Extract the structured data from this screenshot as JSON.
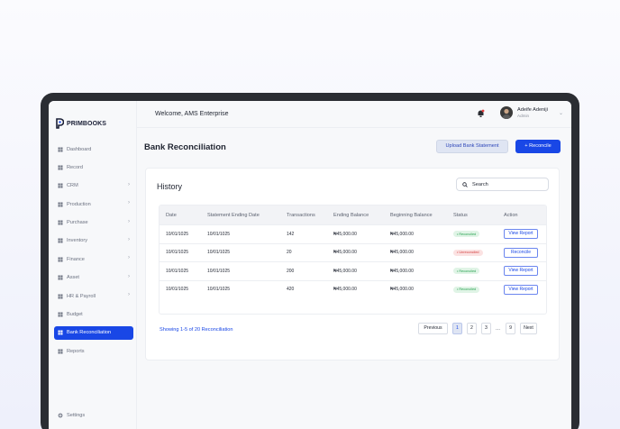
{
  "app": {
    "logo_text": "PRIMBOOKS"
  },
  "sidebar": {
    "items": [
      {
        "label": "Dashboard",
        "icon": "dashboard-icon",
        "has_chevron": false
      },
      {
        "label": "Record",
        "icon": "record-icon",
        "has_chevron": false
      },
      {
        "label": "CRM",
        "icon": "crm-icon",
        "has_chevron": true
      },
      {
        "label": "Production",
        "icon": "production-icon",
        "has_chevron": true
      },
      {
        "label": "Purchase",
        "icon": "purchase-icon",
        "has_chevron": true
      },
      {
        "label": "Inventory",
        "icon": "inventory-icon",
        "has_chevron": true
      },
      {
        "label": "Finance",
        "icon": "finance-icon",
        "has_chevron": true
      },
      {
        "label": "Asset",
        "icon": "asset-icon",
        "has_chevron": true
      },
      {
        "label": "HR & Payroll",
        "icon": "hr-icon",
        "has_chevron": true
      },
      {
        "label": "Budget",
        "icon": "budget-icon",
        "has_chevron": false
      },
      {
        "label": "Bank Reconciliation",
        "icon": "bank-icon",
        "has_chevron": false
      },
      {
        "label": "Reports",
        "icon": "reports-icon",
        "has_chevron": false
      }
    ],
    "active_index": 10,
    "settings_label": "Settings"
  },
  "header": {
    "welcome": "Welcome, AMS Enterprise",
    "user_name": "Adeife Adeniji",
    "user_role": "Admin"
  },
  "main": {
    "title": "Bank Reconciliation",
    "upload_button": "Upload Bank Statement",
    "reconcile_button": "+ Reconcile",
    "history_title": "History",
    "search_placeholder": "Search",
    "columns": [
      "Date",
      "Statement Ending Date",
      "Transactions",
      "Ending Balance",
      "Beginning Balance",
      "Status",
      "Action"
    ],
    "rows": [
      {
        "date": "10/01/1025",
        "ending_date": "10/01/1025",
        "transactions": "142",
        "ending_balance": "₦45,000.00",
        "beginning_balance": "₦45,000.00",
        "status": "• Reconciled",
        "status_type": "ok",
        "action": "View Report"
      },
      {
        "date": "10/01/1025",
        "ending_date": "10/01/1025",
        "transactions": "20",
        "ending_balance": "₦45,000.00",
        "beginning_balance": "₦45,000.00",
        "status": "• Unreconciled",
        "status_type": "bad",
        "action": "Reconcile"
      },
      {
        "date": "10/01/1025",
        "ending_date": "10/01/1025",
        "transactions": "200",
        "ending_balance": "₦45,000.00",
        "beginning_balance": "₦45,000.00",
        "status": "• Reconciled",
        "status_type": "ok",
        "action": "View Report"
      },
      {
        "date": "10/01/1025",
        "ending_date": "10/01/1025",
        "transactions": "420",
        "ending_balance": "₦45,000.00",
        "beginning_balance": "₦45,000.00",
        "status": "• Reconciled",
        "status_type": "ok",
        "action": "View Report"
      }
    ],
    "showing_text": "Showing 1-5 of 20 Reconciliation",
    "pager": {
      "previous": "Previous",
      "pages": [
        "1",
        "2",
        "3"
      ],
      "ellipsis": "...",
      "last": "9",
      "next": "Next",
      "active_page": "1"
    }
  },
  "colors": {
    "accent": "#1947e6",
    "reconciled": "#27a150",
    "unreconciled": "#d23b3b"
  }
}
